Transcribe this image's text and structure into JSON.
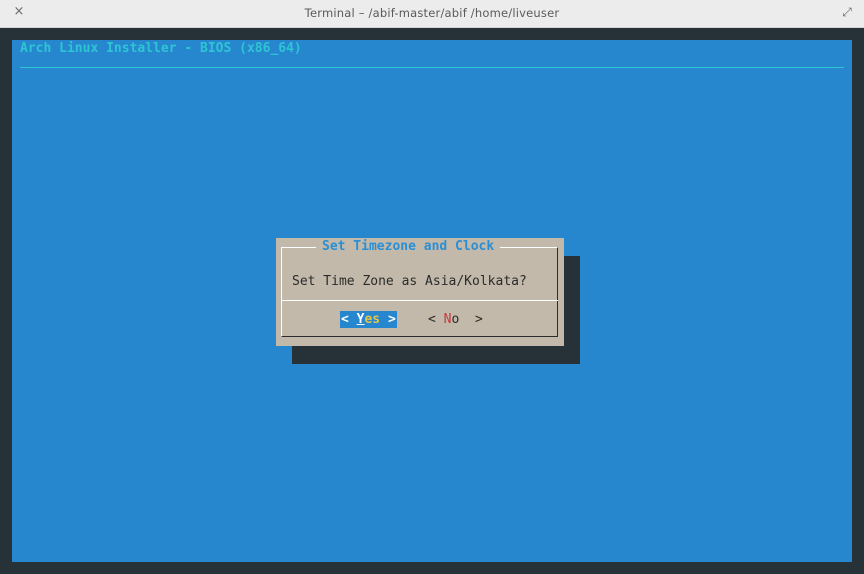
{
  "window": {
    "title": "Terminal – /abif-master/abif /home/liveuser",
    "close_glyph": "×",
    "maximize_glyph": "⤢"
  },
  "installer": {
    "backtitle": "Arch Linux Installer - BIOS (x86_64)"
  },
  "dialog": {
    "title": "Set Timezone and Clock",
    "message": "Set Time Zone as Asia/Kolkata?",
    "yes_button": {
      "open": "< ",
      "hotkey": "Y",
      "rest": "es",
      "close": " >",
      "selected": true
    },
    "no_button": {
      "open": "< ",
      "hotkey": "N",
      "rest": "o",
      "close": "  >",
      "selected": false
    }
  },
  "colors": {
    "screen_background": "#2687cf",
    "backtitle": "#2ec5d3",
    "dialog_background": "#c2b9aa",
    "dialog_title": "#2a8fd4",
    "shadow": "#263238",
    "hotkey_yes": "#e3c44a",
    "hotkey_no": "#c53a3a"
  }
}
